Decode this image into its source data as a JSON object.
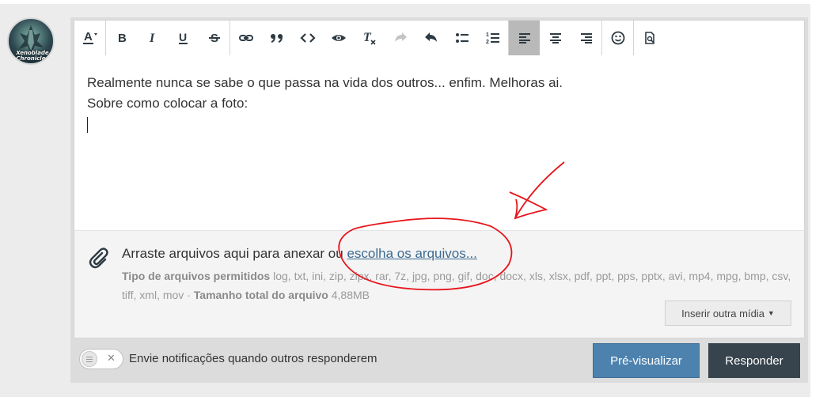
{
  "avatar": {
    "badge_text": "Xenoblade Chronicles"
  },
  "toolbar": {
    "buttons": [
      {
        "name": "text-color",
        "glyph": "A"
      },
      {
        "name": "bold",
        "glyph": "B"
      },
      {
        "name": "italic",
        "glyph": "I"
      },
      {
        "name": "underline",
        "glyph": "U"
      },
      {
        "name": "strikethrough",
        "glyph": "S"
      },
      {
        "name": "link",
        "glyph": "link-icon"
      },
      {
        "name": "quote",
        "glyph": "quote-icon"
      },
      {
        "name": "code",
        "glyph": "code-icon"
      },
      {
        "name": "spoiler",
        "glyph": "eye-icon"
      },
      {
        "name": "remove-format",
        "glyph": "clear-format-icon"
      },
      {
        "name": "redo",
        "glyph": "redo-icon",
        "disabled": true
      },
      {
        "name": "undo",
        "glyph": "undo-icon"
      },
      {
        "name": "bullet-list",
        "glyph": "bullet-list-icon"
      },
      {
        "name": "numbered-list",
        "glyph": "numbered-list-icon"
      },
      {
        "name": "align-left",
        "glyph": "align-left-icon",
        "active": true
      },
      {
        "name": "align-center",
        "glyph": "align-center-icon"
      },
      {
        "name": "align-right",
        "glyph": "align-right-icon"
      },
      {
        "name": "emoji",
        "glyph": "smiley-icon"
      },
      {
        "name": "preview-toggle",
        "glyph": "preview-icon"
      }
    ]
  },
  "editor": {
    "lines": [
      "Realmente nunca se sabe o que passa na vida dos outros... enfim. Melhoras ai.",
      "Sobre como colocar a foto:"
    ]
  },
  "attachments": {
    "drop_text": "Arraste arquivos aqui para anexar ou ",
    "choose_link": "escolha os arquivos...",
    "types_label": "Tipo de arquivos permitidos",
    "types_list": "log, txt, ini, zip, zipx, rar, 7z, jpg, png, gif, doc, docx, xls, xlsx, pdf, ppt, pps, pptx, avi, mp4, mpg, bmp, csv, tiff, xml, mov",
    "separator": " · ",
    "size_label": "Tamanho total do arquivo",
    "size_value": "4,88MB",
    "media_button": "Inserir outra mídia"
  },
  "footer": {
    "notify_label": "Envie notificações quando outros responderem",
    "preview_button": "Pré-visualizar",
    "reply_button": "Responder"
  },
  "colors": {
    "primary_button": "#4d82ae",
    "dark_button": "#37444d",
    "link": "#3d6a91",
    "annotation": "#e8141b"
  }
}
